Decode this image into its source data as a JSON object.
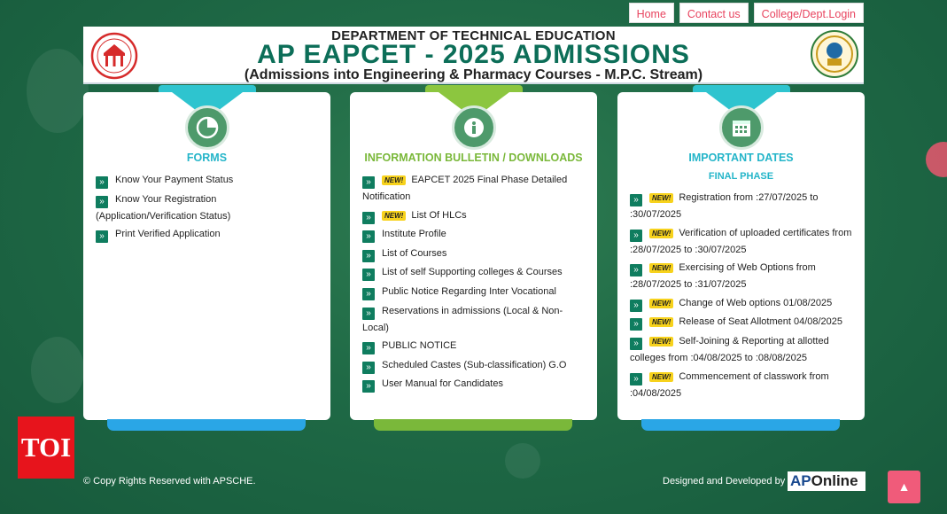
{
  "nav": {
    "home": "Home",
    "contact": "Contact us",
    "login": "College/Dept.Login"
  },
  "header": {
    "dept": "DEPARTMENT OF TECHNICAL EDUCATION",
    "title": "AP EAPCET - 2025 ADMISSIONS",
    "subtitle": "(Admissions into Engineering & Pharmacy Courses - M.P.C. Stream)"
  },
  "new_badge": "NEW!",
  "cards": {
    "forms": {
      "title": "FORMS",
      "items": [
        "Know Your Payment Status",
        "Know Your Registration (Application/Verification Status)",
        "Print Verified Application"
      ]
    },
    "info": {
      "title": "INFORMATION BULLETIN / DOWNLOADS",
      "items": [
        "EAPCET 2025 Final Phase Detailed Notification",
        "List Of HLCs",
        "Institute Profile",
        "List of Courses",
        "List of self Supporting colleges & Courses",
        "Public Notice Regarding Inter Vocational",
        "Reservations in admissions (Local & Non-Local)",
        "PUBLIC NOTICE",
        "Scheduled Castes (Sub-classification) G.O",
        "User Manual for Candidates"
      ]
    },
    "dates": {
      "title": "IMPORTANT DATES",
      "subtitle": "FINAL PHASE",
      "items": [
        "Registration from :27/07/2025 to :30/07/2025",
        "Verification of uploaded certificates from :28/07/2025 to :30/07/2025",
        "Exercising of Web Options from :28/07/2025 to :31/07/2025",
        "Change of Web options 01/08/2025",
        "Release of Seat Allotment 04/08/2025",
        "Self-Joining & Reporting at allotted colleges from :04/08/2025 to :08/08/2025",
        "Commencement of classwork from :04/08/2025"
      ]
    }
  },
  "footer": {
    "copyright": "© Copy Rights Reserved with APSCHE.",
    "designed": "Designed and Developed by",
    "brand_ap": "AP",
    "brand_online": "Online"
  },
  "watermark": "TOI",
  "colors": {
    "forms_accent": "#2ec4cf",
    "info_accent": "#8cc63f",
    "dates_accent": "#2ec4cf",
    "title_green": "#0c6e58"
  }
}
